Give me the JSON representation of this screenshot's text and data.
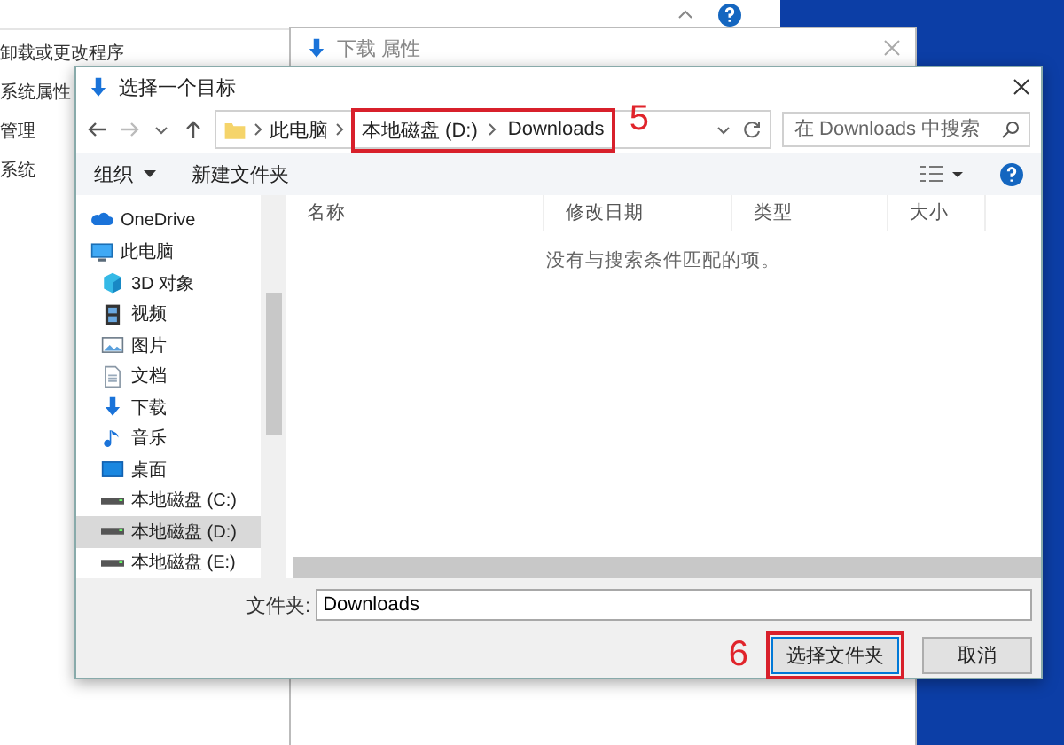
{
  "control_panel": {
    "items": [
      "卸载或更改程序",
      "系统属性",
      "管理",
      "系统"
    ]
  },
  "properties_window": {
    "title": "下载 属性"
  },
  "dialog": {
    "title": "选择一个目标",
    "breadcrumb": [
      "此电脑"
    ],
    "highlighted_breadcrumb": [
      "本地磁盘 (D:)",
      "Downloads"
    ],
    "breadcrumb_callout": "5",
    "search": {
      "placeholder": "在 Downloads 中搜索"
    },
    "toolbar": {
      "organize": "组织",
      "new_folder": "新建文件夹"
    },
    "sidebar": [
      {
        "label": "OneDrive",
        "kind": "cloud",
        "selected": false
      },
      {
        "label": "此电脑",
        "kind": "computer",
        "selected": false,
        "children": [
          {
            "label": "3D 对象",
            "kind": "cube",
            "selected": false
          },
          {
            "label": "视频",
            "kind": "film",
            "selected": false
          },
          {
            "label": "图片",
            "kind": "picture",
            "selected": false
          },
          {
            "label": "文档",
            "kind": "document",
            "selected": false
          },
          {
            "label": "下载",
            "kind": "download",
            "selected": false
          },
          {
            "label": "音乐",
            "kind": "music",
            "selected": false
          },
          {
            "label": "桌面",
            "kind": "desktop",
            "selected": false
          },
          {
            "label": "本地磁盘 (C:)",
            "kind": "drive",
            "selected": false
          },
          {
            "label": "本地磁盘 (D:)",
            "kind": "drive",
            "selected": true
          },
          {
            "label": "本地磁盘 (E:)",
            "kind": "drive",
            "selected": false
          }
        ]
      }
    ],
    "columns": [
      "名称",
      "修改日期",
      "类型",
      "大小"
    ],
    "empty_message": "没有与搜索条件匹配的项。",
    "folder_label": "文件夹:",
    "folder_value": "Downloads",
    "buttons": [
      {
        "label": "选择文件夹",
        "kind": "primary",
        "callout": "6"
      },
      {
        "label": "取消",
        "kind": "secondary"
      }
    ]
  }
}
